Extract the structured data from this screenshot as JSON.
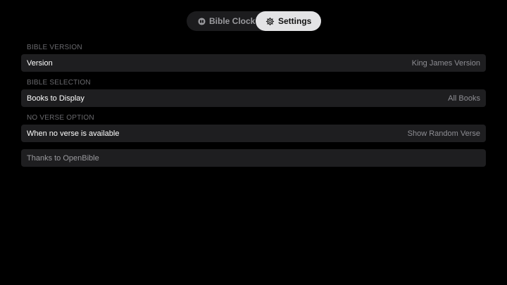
{
  "tabs": {
    "clock_label": "Bible Clock",
    "settings_label": "Settings"
  },
  "sections": [
    {
      "header": "BIBLE VERSION",
      "label": "Version",
      "value": "King James Version"
    },
    {
      "header": "BIBLE SELECTION",
      "label": "Books to Display",
      "value": "All Books"
    },
    {
      "header": "NO VERSE OPTION",
      "label": "When no verse is available",
      "value": "Show Random Verse"
    }
  ],
  "credits": {
    "label": "Thanks to OpenBible"
  },
  "colors": {
    "background": "#000000",
    "row_background": "#1e1e20",
    "selected_tab": "#e3e3e5"
  },
  "icons": {
    "clock_tab": "book-icon",
    "settings_tab": "gear-icon"
  }
}
